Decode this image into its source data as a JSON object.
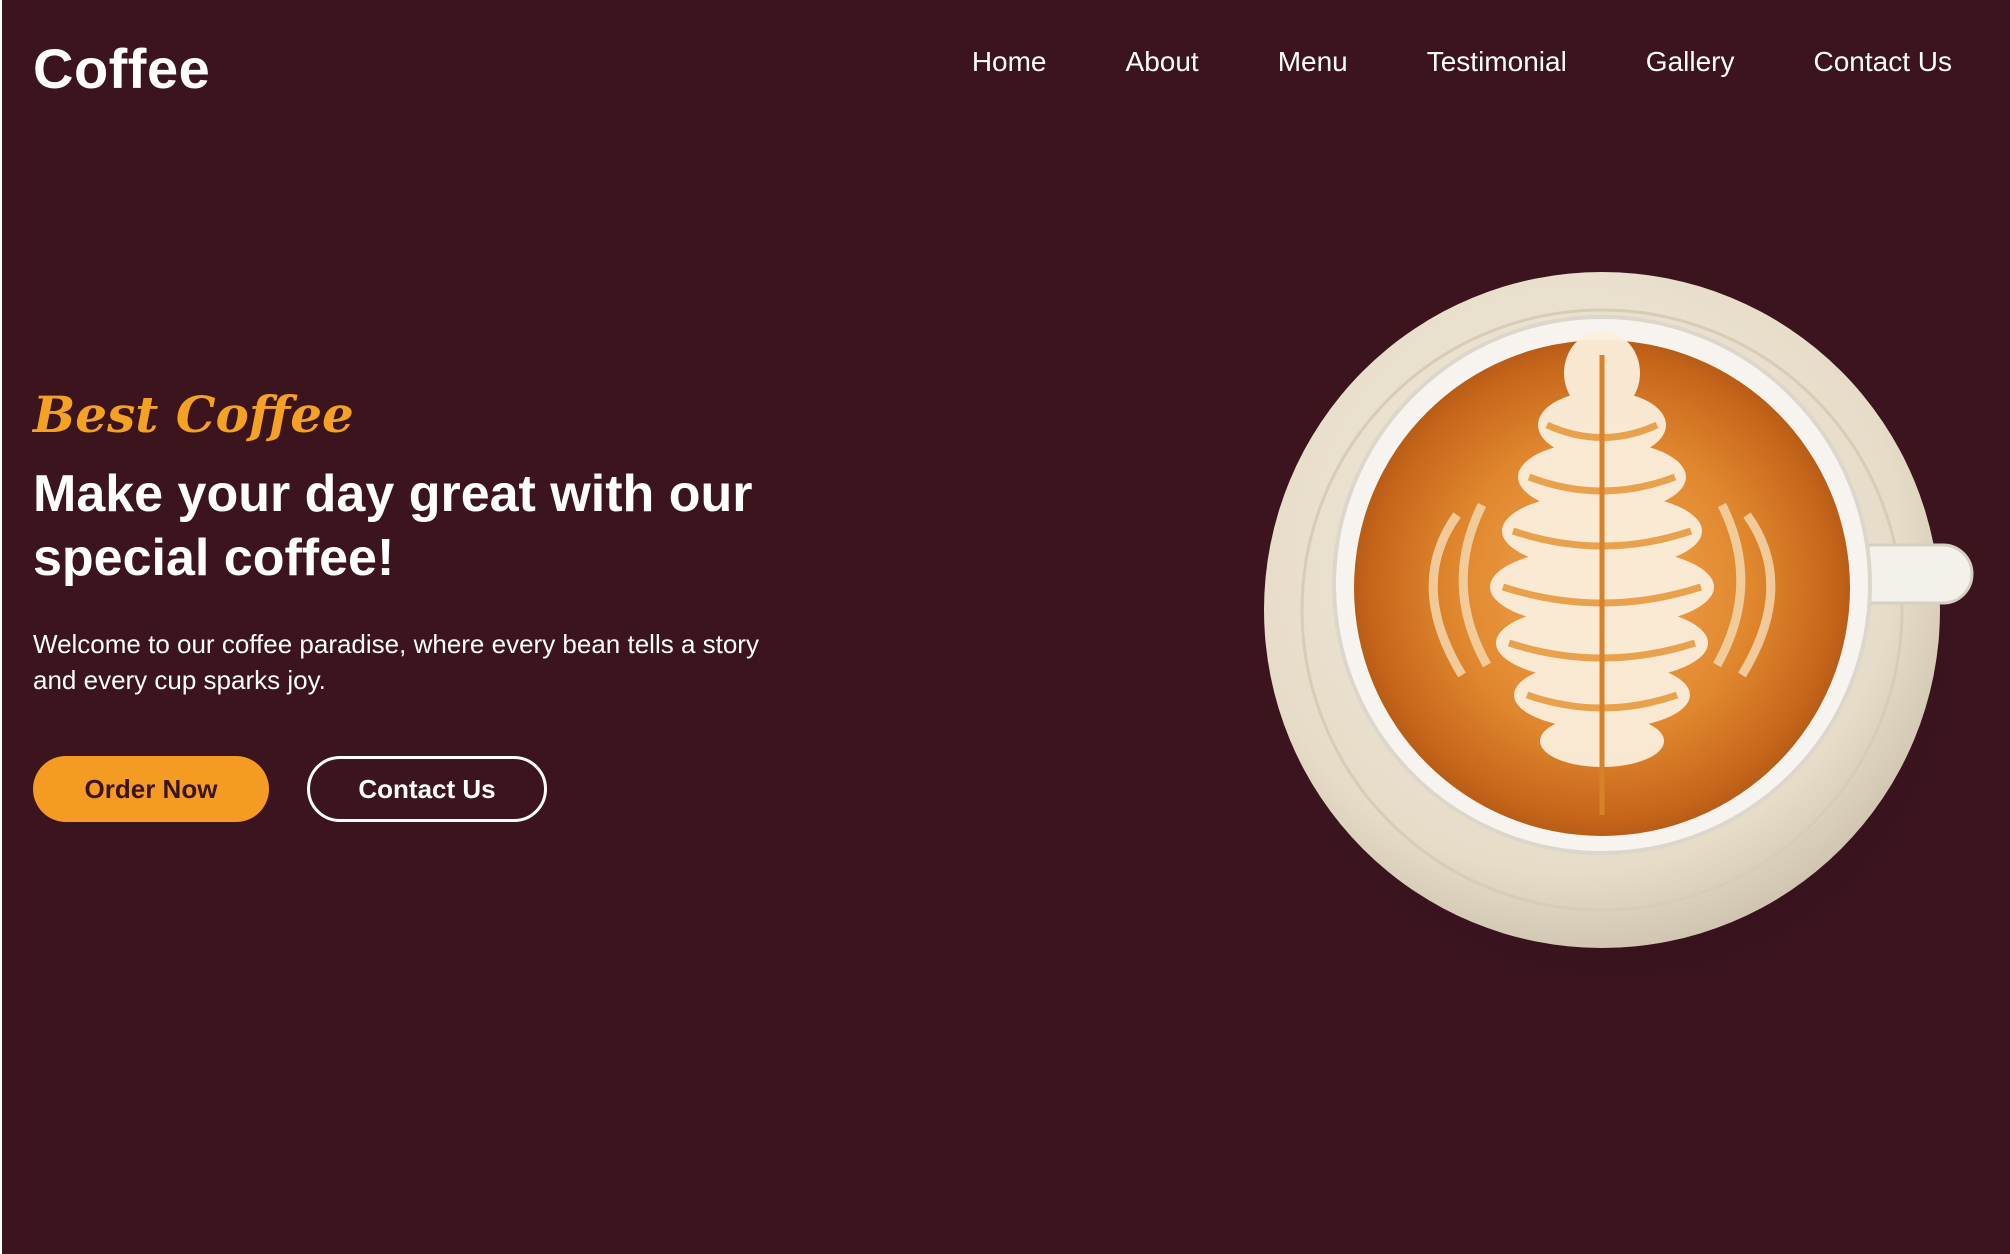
{
  "header": {
    "logo": "Coffee",
    "nav": [
      "Home",
      "About",
      "Menu",
      "Testimonial",
      "Gallery",
      "Contact Us"
    ]
  },
  "hero": {
    "tagline": "Best Coffee",
    "headline_line1": "Make your day great with our",
    "headline_line2": "special coffee!",
    "description": "Welcome to our coffee paradise, where every bean tells a story and every cup sparks joy.",
    "primary_button": "Order Now",
    "secondary_button": "Contact Us"
  },
  "image": {
    "name": "coffee-cup-latte-art"
  },
  "colors": {
    "background": "#3b141e",
    "accent": "#f39b22",
    "text": "#ffffff"
  }
}
